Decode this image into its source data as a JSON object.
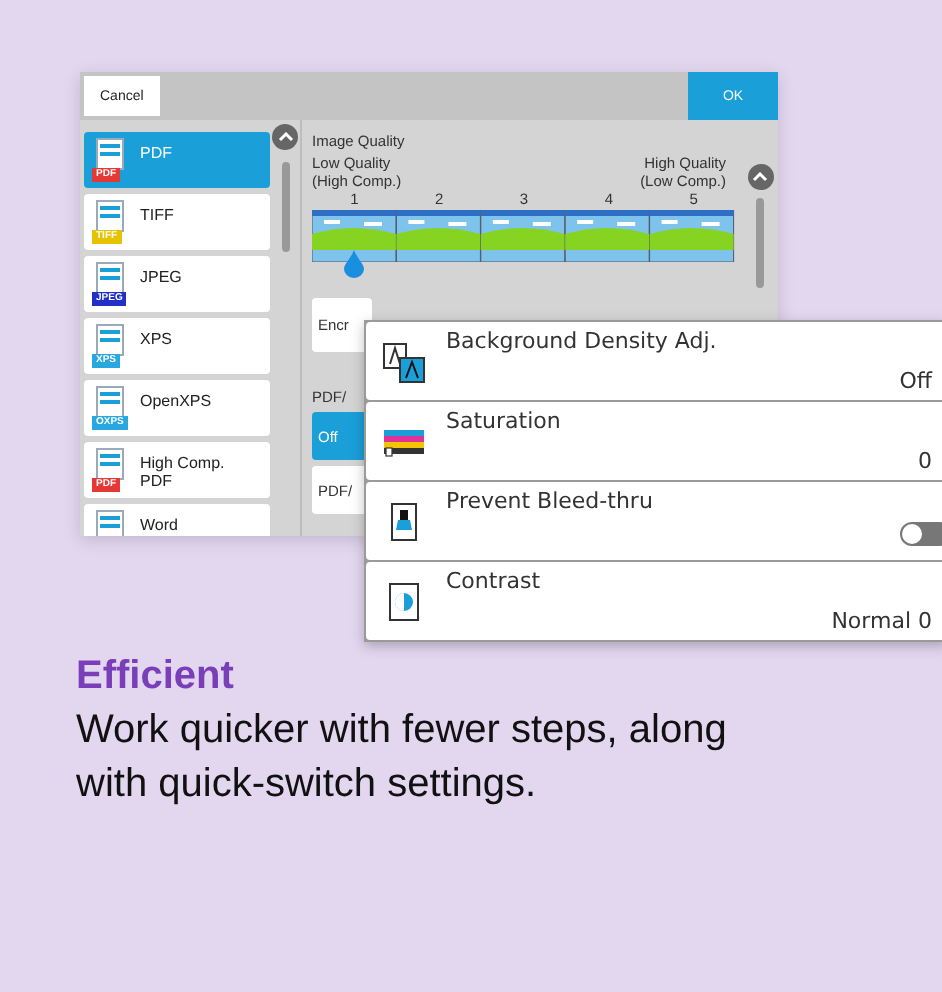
{
  "screen": {
    "cancel_button": "Cancel",
    "ok_button": "OK",
    "formats": [
      {
        "label": "PDF",
        "badge": "PDF",
        "color": "#e53935",
        "selected": true
      },
      {
        "label": "TIFF",
        "badge": "TIFF",
        "color": "#e6c300",
        "selected": false
      },
      {
        "label": "JPEG",
        "badge": "JPEG",
        "color": "#2330c8",
        "selected": false
      },
      {
        "label": "XPS",
        "badge": "XPS",
        "color": "#29a8e0",
        "selected": false
      },
      {
        "label": "OpenXPS",
        "badge": "OXPS",
        "color": "#29a8e0",
        "selected": false
      },
      {
        "label": "High Comp. PDF",
        "badge": "PDF",
        "color": "#e53935",
        "selected": false
      },
      {
        "label": "Word",
        "selected": false
      }
    ],
    "image_quality": {
      "title": "Image Quality",
      "low_label": "Low Quality",
      "low_note": "(High Comp.)",
      "high_label": "High Quality",
      "high_note": "(Low Comp.)",
      "ticks": [
        {
          "label": "1",
          "selected": true
        },
        {
          "label": "2",
          "selected": false
        },
        {
          "label": "3",
          "selected": false
        },
        {
          "label": "4",
          "selected": false
        },
        {
          "label": "5",
          "selected": false
        }
      ]
    },
    "encryption_button": "Encr",
    "pdfa_label": "PDF/",
    "pdfa_options": [
      {
        "label": "Off",
        "selected": true
      },
      {
        "label": "PDF/",
        "selected": false
      }
    ]
  },
  "popup": [
    {
      "kind": "value",
      "label": "Background Density Adj.",
      "value": "Off"
    },
    {
      "kind": "value",
      "label": "Saturation",
      "value": "0"
    },
    {
      "kind": "toggle",
      "label": "Prevent Bleed-thru",
      "on": false
    },
    {
      "kind": "value",
      "label": "Contrast",
      "value": "Normal 0"
    }
  ],
  "heading": "Efficient",
  "body": "Work quicker with fewer steps, along with quick-switch settings."
}
